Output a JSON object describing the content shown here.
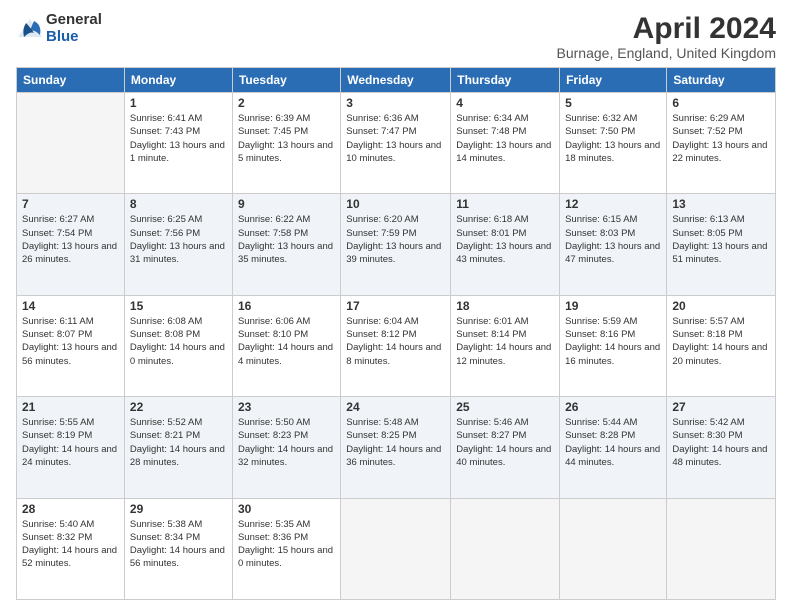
{
  "header": {
    "logo_general": "General",
    "logo_blue": "Blue",
    "main_title": "April 2024",
    "subtitle": "Burnage, England, United Kingdom"
  },
  "days_of_week": [
    "Sunday",
    "Monday",
    "Tuesday",
    "Wednesday",
    "Thursday",
    "Friday",
    "Saturday"
  ],
  "weeks": [
    [
      {
        "day": "",
        "sunrise": "",
        "sunset": "",
        "daylight": ""
      },
      {
        "day": "1",
        "sunrise": "Sunrise: 6:41 AM",
        "sunset": "Sunset: 7:43 PM",
        "daylight": "Daylight: 13 hours and 1 minute."
      },
      {
        "day": "2",
        "sunrise": "Sunrise: 6:39 AM",
        "sunset": "Sunset: 7:45 PM",
        "daylight": "Daylight: 13 hours and 5 minutes."
      },
      {
        "day": "3",
        "sunrise": "Sunrise: 6:36 AM",
        "sunset": "Sunset: 7:47 PM",
        "daylight": "Daylight: 13 hours and 10 minutes."
      },
      {
        "day": "4",
        "sunrise": "Sunrise: 6:34 AM",
        "sunset": "Sunset: 7:48 PM",
        "daylight": "Daylight: 13 hours and 14 minutes."
      },
      {
        "day": "5",
        "sunrise": "Sunrise: 6:32 AM",
        "sunset": "Sunset: 7:50 PM",
        "daylight": "Daylight: 13 hours and 18 minutes."
      },
      {
        "day": "6",
        "sunrise": "Sunrise: 6:29 AM",
        "sunset": "Sunset: 7:52 PM",
        "daylight": "Daylight: 13 hours and 22 minutes."
      }
    ],
    [
      {
        "day": "7",
        "sunrise": "Sunrise: 6:27 AM",
        "sunset": "Sunset: 7:54 PM",
        "daylight": "Daylight: 13 hours and 26 minutes."
      },
      {
        "day": "8",
        "sunrise": "Sunrise: 6:25 AM",
        "sunset": "Sunset: 7:56 PM",
        "daylight": "Daylight: 13 hours and 31 minutes."
      },
      {
        "day": "9",
        "sunrise": "Sunrise: 6:22 AM",
        "sunset": "Sunset: 7:58 PM",
        "daylight": "Daylight: 13 hours and 35 minutes."
      },
      {
        "day": "10",
        "sunrise": "Sunrise: 6:20 AM",
        "sunset": "Sunset: 7:59 PM",
        "daylight": "Daylight: 13 hours and 39 minutes."
      },
      {
        "day": "11",
        "sunrise": "Sunrise: 6:18 AM",
        "sunset": "Sunset: 8:01 PM",
        "daylight": "Daylight: 13 hours and 43 minutes."
      },
      {
        "day": "12",
        "sunrise": "Sunrise: 6:15 AM",
        "sunset": "Sunset: 8:03 PM",
        "daylight": "Daylight: 13 hours and 47 minutes."
      },
      {
        "day": "13",
        "sunrise": "Sunrise: 6:13 AM",
        "sunset": "Sunset: 8:05 PM",
        "daylight": "Daylight: 13 hours and 51 minutes."
      }
    ],
    [
      {
        "day": "14",
        "sunrise": "Sunrise: 6:11 AM",
        "sunset": "Sunset: 8:07 PM",
        "daylight": "Daylight: 13 hours and 56 minutes."
      },
      {
        "day": "15",
        "sunrise": "Sunrise: 6:08 AM",
        "sunset": "Sunset: 8:08 PM",
        "daylight": "Daylight: 14 hours and 0 minutes."
      },
      {
        "day": "16",
        "sunrise": "Sunrise: 6:06 AM",
        "sunset": "Sunset: 8:10 PM",
        "daylight": "Daylight: 14 hours and 4 minutes."
      },
      {
        "day": "17",
        "sunrise": "Sunrise: 6:04 AM",
        "sunset": "Sunset: 8:12 PM",
        "daylight": "Daylight: 14 hours and 8 minutes."
      },
      {
        "day": "18",
        "sunrise": "Sunrise: 6:01 AM",
        "sunset": "Sunset: 8:14 PM",
        "daylight": "Daylight: 14 hours and 12 minutes."
      },
      {
        "day": "19",
        "sunrise": "Sunrise: 5:59 AM",
        "sunset": "Sunset: 8:16 PM",
        "daylight": "Daylight: 14 hours and 16 minutes."
      },
      {
        "day": "20",
        "sunrise": "Sunrise: 5:57 AM",
        "sunset": "Sunset: 8:18 PM",
        "daylight": "Daylight: 14 hours and 20 minutes."
      }
    ],
    [
      {
        "day": "21",
        "sunrise": "Sunrise: 5:55 AM",
        "sunset": "Sunset: 8:19 PM",
        "daylight": "Daylight: 14 hours and 24 minutes."
      },
      {
        "day": "22",
        "sunrise": "Sunrise: 5:52 AM",
        "sunset": "Sunset: 8:21 PM",
        "daylight": "Daylight: 14 hours and 28 minutes."
      },
      {
        "day": "23",
        "sunrise": "Sunrise: 5:50 AM",
        "sunset": "Sunset: 8:23 PM",
        "daylight": "Daylight: 14 hours and 32 minutes."
      },
      {
        "day": "24",
        "sunrise": "Sunrise: 5:48 AM",
        "sunset": "Sunset: 8:25 PM",
        "daylight": "Daylight: 14 hours and 36 minutes."
      },
      {
        "day": "25",
        "sunrise": "Sunrise: 5:46 AM",
        "sunset": "Sunset: 8:27 PM",
        "daylight": "Daylight: 14 hours and 40 minutes."
      },
      {
        "day": "26",
        "sunrise": "Sunrise: 5:44 AM",
        "sunset": "Sunset: 8:28 PM",
        "daylight": "Daylight: 14 hours and 44 minutes."
      },
      {
        "day": "27",
        "sunrise": "Sunrise: 5:42 AM",
        "sunset": "Sunset: 8:30 PM",
        "daylight": "Daylight: 14 hours and 48 minutes."
      }
    ],
    [
      {
        "day": "28",
        "sunrise": "Sunrise: 5:40 AM",
        "sunset": "Sunset: 8:32 PM",
        "daylight": "Daylight: 14 hours and 52 minutes."
      },
      {
        "day": "29",
        "sunrise": "Sunrise: 5:38 AM",
        "sunset": "Sunset: 8:34 PM",
        "daylight": "Daylight: 14 hours and 56 minutes."
      },
      {
        "day": "30",
        "sunrise": "Sunrise: 5:35 AM",
        "sunset": "Sunset: 8:36 PM",
        "daylight": "Daylight: 15 hours and 0 minutes."
      },
      {
        "day": "",
        "sunrise": "",
        "sunset": "",
        "daylight": ""
      },
      {
        "day": "",
        "sunrise": "",
        "sunset": "",
        "daylight": ""
      },
      {
        "day": "",
        "sunrise": "",
        "sunset": "",
        "daylight": ""
      },
      {
        "day": "",
        "sunrise": "",
        "sunset": "",
        "daylight": ""
      }
    ]
  ]
}
